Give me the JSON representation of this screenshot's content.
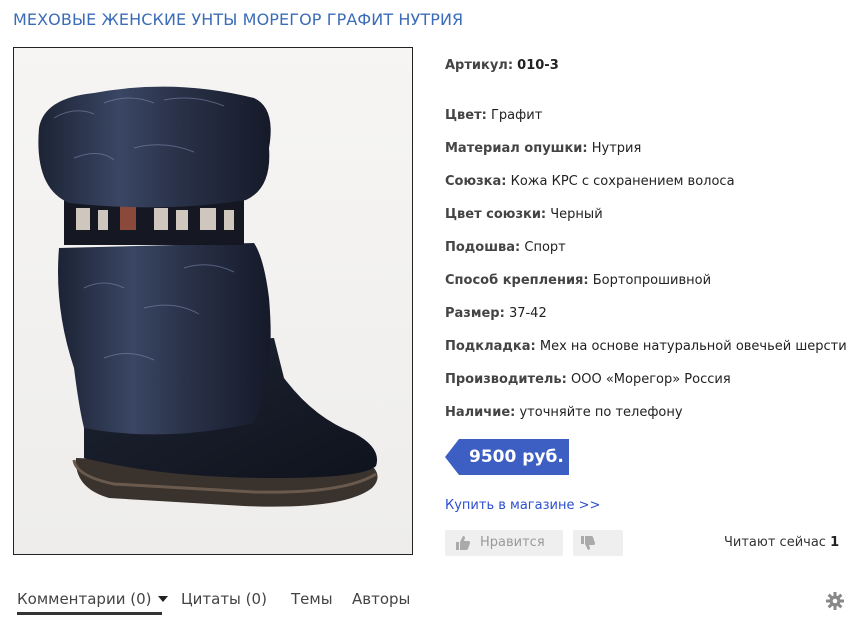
{
  "page_title": "МЕХОВЫЕ ЖЕНСКИЕ УНТЫ МОРЕГОР ГРАФИТ НУТРИЯ",
  "article": {
    "label": "Артикул:",
    "value": "010-3"
  },
  "specs": [
    {
      "label": "Цвет:",
      "value": "Графит"
    },
    {
      "label": "Материал опушки:",
      "value": "Нутрия"
    },
    {
      "label": "Союзка:",
      "value": "Кожа КРС с сохранением волоса"
    },
    {
      "label": "Цвет союзки:",
      "value": "Черный"
    },
    {
      "label": "Подошва:",
      "value": "Спорт"
    },
    {
      "label": "Способ крепления:",
      "value": "Бортопрошивной"
    },
    {
      "label": "Размер:",
      "value": "37-42"
    },
    {
      "label": "Подкладка:",
      "value": "Мех на основе натуральной овечьей шерсти"
    },
    {
      "label": "Производитель:",
      "value": "ООО «Морегор» Россия"
    },
    {
      "label": "Наличие:",
      "value": "уточняйте по телефону"
    }
  ],
  "price": "9500 руб.",
  "buy_link": "Купить в магазине >>",
  "like_label": "Нравится",
  "readers": {
    "label": "Читают сейчас",
    "count": "1"
  },
  "tabs": [
    {
      "label": "Комментарии (0)"
    },
    {
      "label": "Цитаты (0)"
    },
    {
      "label": "Темы"
    },
    {
      "label": "Авторы"
    }
  ],
  "colors": {
    "title": "#3b6cb8",
    "price_badge": "#3d5fc4",
    "link": "#2b4fd0"
  },
  "icons": [
    "thumbs-up-icon",
    "thumbs-down-icon",
    "gear-icon",
    "caret-down-icon"
  ]
}
